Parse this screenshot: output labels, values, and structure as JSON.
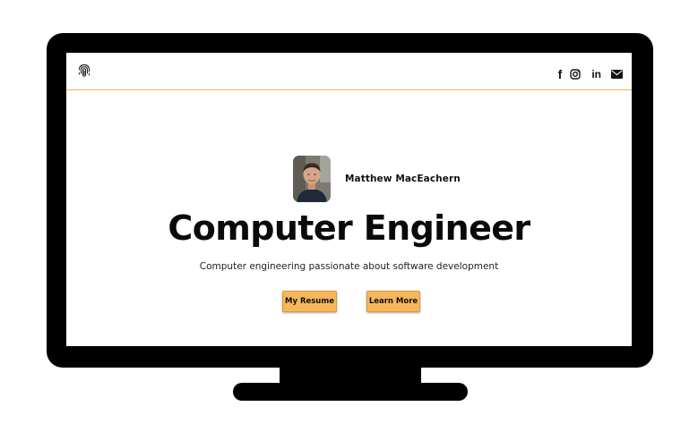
{
  "navbar": {
    "logo_icon": "fingerprint-icon",
    "social": [
      {
        "name": "facebook",
        "icon": "facebook-icon",
        "glyph": "f"
      },
      {
        "name": "instagram",
        "icon": "instagram-icon"
      },
      {
        "name": "linkedin",
        "icon": "linkedin-icon",
        "glyph": "in"
      },
      {
        "name": "email",
        "icon": "envelope-icon"
      }
    ]
  },
  "hero": {
    "name": "Matthew MacEachern",
    "headline": "Computer Engineer",
    "subtitle": "Computer engineering passionate about software development",
    "buttons": {
      "resume": "My Resume",
      "learn_more": "Learn More"
    }
  },
  "colors": {
    "accent": "#f2b24d",
    "button": "#f6b75a",
    "bezel": "#000000",
    "text": "#0a0a0a"
  }
}
